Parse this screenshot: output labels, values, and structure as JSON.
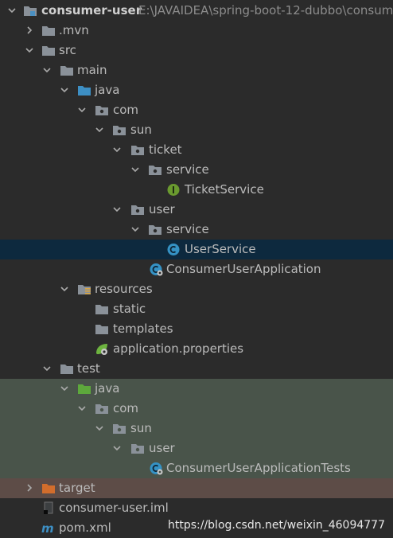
{
  "project": {
    "name": "consumer-user",
    "path": "E:\\JAVAIDEA\\spring-boot-12-dubbo\\consum"
  },
  "nodes": {
    "mvn": ".mvn",
    "src": "src",
    "main": "main",
    "java_main": "java",
    "com_main": "com",
    "sun_main": "sun",
    "ticket": "ticket",
    "ticket_service_pkg": "service",
    "ticket_service_class": "TicketService",
    "user_pkg": "user",
    "user_service_pkg": "service",
    "user_service_class": "UserService",
    "app_class": "ConsumerUserApplication",
    "resources": "resources",
    "static": "static",
    "templates": "templates",
    "app_props": "application.properties",
    "test": "test",
    "java_test": "java",
    "com_test": "com",
    "sun_test": "sun",
    "user_test_pkg": "user",
    "app_tests_class": "ConsumerUserApplicationTests",
    "target": "target",
    "iml": "consumer-user.iml",
    "pom": "pom.xml"
  },
  "watermark": "https://blog.csdn.net/weixin_46094777",
  "icons": {
    "folder": "folder-icon",
    "package": "package-icon",
    "interface": "interface-icon",
    "class": "class-icon",
    "spring_class": "spring-class-icon",
    "resources": "resources-folder-icon",
    "properties": "spring-properties-icon",
    "iml": "module-file-icon",
    "maven": "maven-icon"
  },
  "colors": {
    "background": "#2b2b2b",
    "selected_row": "#0d293e",
    "test_tint": "#49544a",
    "excluded_tint": "#5d4c47",
    "folder": "#8a9199",
    "source_root": "#3d8fc4",
    "test_root": "#5da83c",
    "excluded": "#d26d2c",
    "interface": "#6a9a2f",
    "class": "#3592c4"
  }
}
